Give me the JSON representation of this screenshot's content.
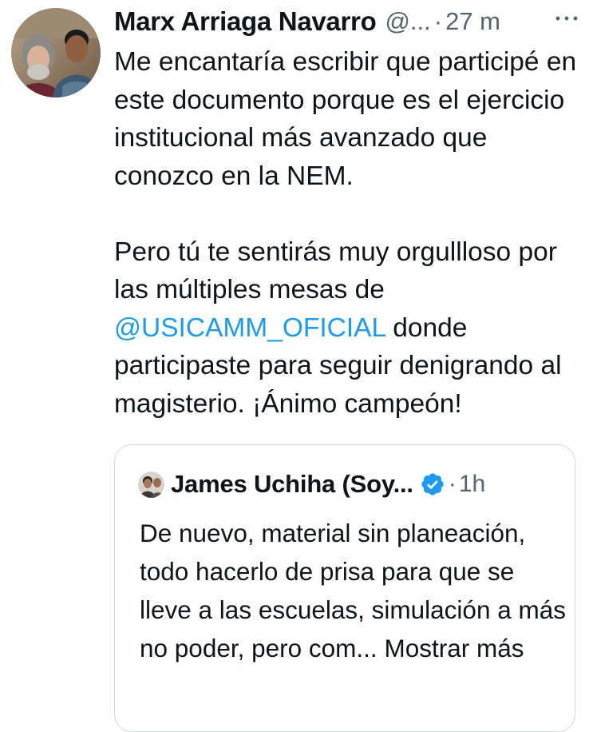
{
  "tweet": {
    "author": {
      "display_name": "Marx Arriaga Navarro",
      "handle": "@...",
      "avatar_icon": "profile-photo-two-men"
    },
    "separator": "·",
    "time": "27 m",
    "more_icon": "more-dots-icon",
    "text": {
      "para1": "Me encantaría escribir que participé en este documento porque es el ejercicio institucional más avanzado que conozco en la NEM.",
      "para2_before": "Pero tú te sentirás muy orgullloso por las múltiples mesas de ",
      "mention": "@USICAMM_OFICIAL",
      "para2_after": " donde participaste para seguir denigrando al magisterio. ¡Ánimo campeón!"
    },
    "colors": {
      "text": "#0f1419",
      "secondary": "#536471",
      "link": "#1d9bf0",
      "border": "#cfd9de"
    }
  },
  "quote": {
    "author": {
      "display_name": "James Uchiha (Soy...",
      "verified_icon": "verified-badge-icon",
      "avatar_icon": "small-profile-photo"
    },
    "separator": "·",
    "time": "1h",
    "text": "De nuevo, material sin planeación, todo hacerlo de prisa para que se lleve a las escuelas, simulación a más no poder, pero com...",
    "show_more": "Mostrar más"
  }
}
